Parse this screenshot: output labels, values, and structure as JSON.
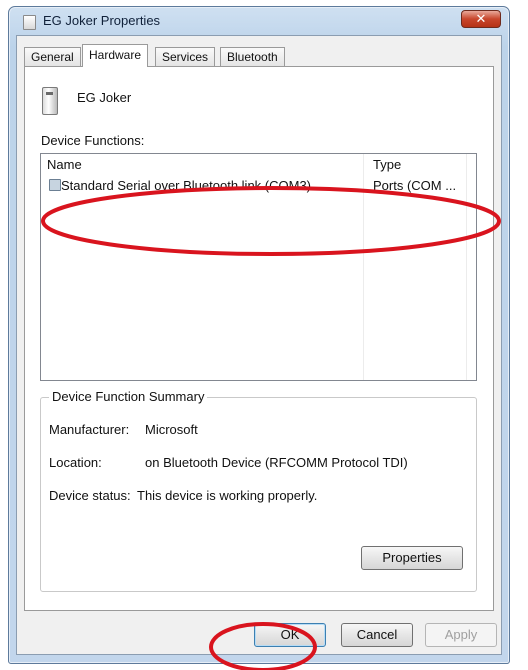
{
  "window": {
    "title": "EG Joker Properties",
    "close_label": "✕"
  },
  "tabs": [
    "General",
    "Hardware",
    "Services",
    "Bluetooth"
  ],
  "active_tab": "Hardware",
  "device": {
    "name": "EG Joker",
    "icon": "device-icon"
  },
  "device_functions": {
    "label": "Device Functions:",
    "columns": [
      "Name",
      "Type"
    ],
    "rows": [
      {
        "name": "Standard Serial over Bluetooth link (COM3)",
        "type": "Ports (COM ...",
        "icon": "serial-port-icon"
      }
    ]
  },
  "summary": {
    "legend": "Device Function Summary",
    "manufacturer_label": "Manufacturer:",
    "manufacturer_value": "Microsoft",
    "location_label": "Location:",
    "location_value": "on Bluetooth Device (RFCOMM Protocol TDI)",
    "status_label": "Device status:",
    "status_value": "This device is working properly.",
    "properties_button": "Properties"
  },
  "buttons": {
    "ok": "OK",
    "cancel": "Cancel",
    "apply": "Apply"
  },
  "colors": {
    "annotation": "#d9141e",
    "titlebar": "#bcd3ea",
    "close": "#c8462c"
  }
}
